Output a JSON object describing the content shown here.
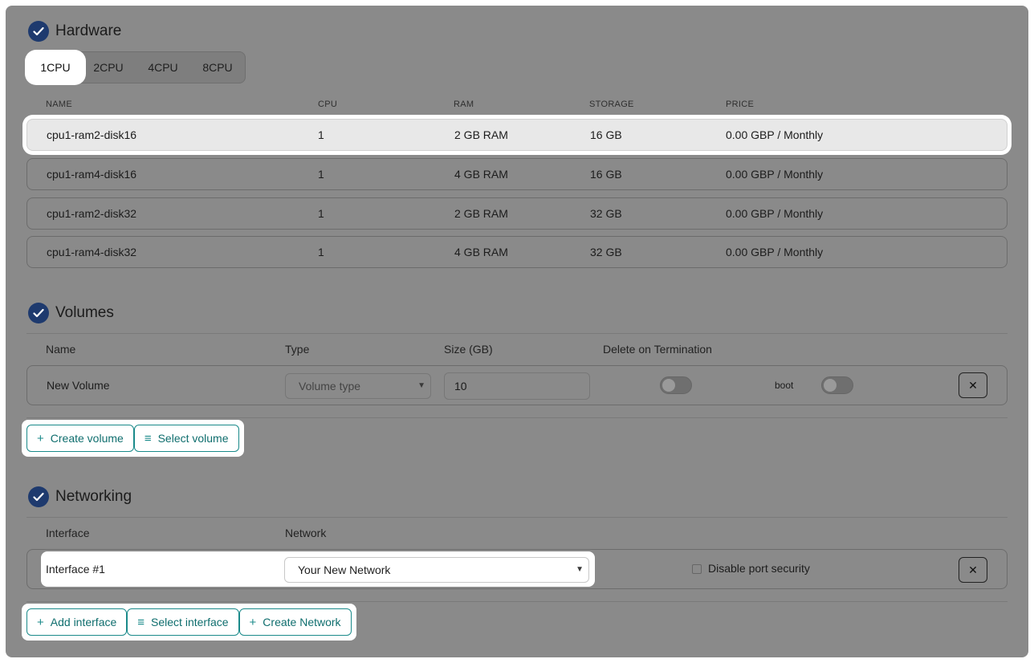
{
  "hardware": {
    "title": "Hardware",
    "tabs": [
      "1CPU",
      "2CPU",
      "4CPU",
      "8CPU"
    ],
    "active_tab": "1CPU",
    "columns": [
      "NAME",
      "CPU",
      "RAM",
      "STORAGE",
      "PRICE"
    ],
    "rows": [
      {
        "name": "cpu1-ram2-disk16",
        "cpu": "1",
        "ram": "2 GB RAM",
        "storage": "16 GB",
        "price": "0.00 GBP / Monthly",
        "selected": true
      },
      {
        "name": "cpu1-ram4-disk16",
        "cpu": "1",
        "ram": "4 GB RAM",
        "storage": "16 GB",
        "price": "0.00 GBP / Monthly",
        "selected": false
      },
      {
        "name": "cpu1-ram2-disk32",
        "cpu": "1",
        "ram": "2 GB RAM",
        "storage": "32 GB",
        "price": "0.00 GBP / Monthly",
        "selected": false
      },
      {
        "name": "cpu1-ram4-disk32",
        "cpu": "1",
        "ram": "4 GB RAM",
        "storage": "32 GB",
        "price": "0.00 GBP / Monthly",
        "selected": false
      }
    ]
  },
  "volumes": {
    "title": "Volumes",
    "columns": [
      "Name",
      "Type",
      "Size (GB)",
      "Delete on Termination"
    ],
    "row": {
      "name": "New Volume",
      "type_placeholder": "Volume type",
      "size": "10",
      "boot_label": "boot",
      "remove_label": "✕"
    },
    "buttons": {
      "create": "Create volume",
      "select": "Select volume"
    }
  },
  "networking": {
    "title": "Networking",
    "columns": [
      "Interface",
      "Network"
    ],
    "row": {
      "interface": "Interface #1",
      "network": "Your New Network",
      "port_security_label": "Disable port security",
      "remove_label": "✕"
    },
    "buttons": {
      "add": "Add interface",
      "select": "Select interface",
      "create": "Create Network"
    }
  },
  "colors": {
    "accent": "#1a8a8a",
    "check": "#1e3a6e",
    "overlay": "#8a8a8a"
  }
}
